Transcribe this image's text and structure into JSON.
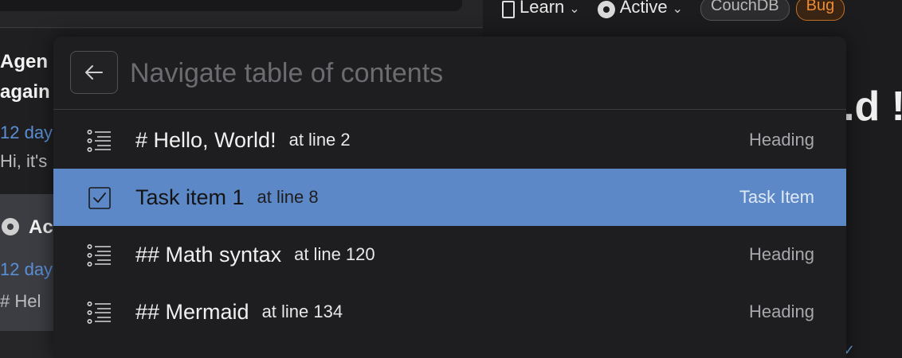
{
  "background": {
    "notes": [
      {
        "title_line1": "Agen",
        "title_line2": "again",
        "date": "12 day",
        "snippet": "Hi, it's"
      },
      {
        "title": "Ac",
        "date": "12 day",
        "snippet": "# Hel"
      }
    ],
    "toolbar": {
      "learn_label": "Learn",
      "status_label": "Active",
      "tags": [
        "CouchDB",
        "Bug"
      ]
    },
    "editor_heading_fragment": ".d !"
  },
  "switcher": {
    "search": {
      "value": "",
      "placeholder": "Navigate table of contents"
    },
    "results": [
      {
        "icon": "list-icon",
        "title": "# Hello, World!",
        "line": "at line 2",
        "kind": "Heading",
        "selected": false
      },
      {
        "icon": "checkbox-icon",
        "title": "Task item 1",
        "line": "at line 8",
        "kind": "Task Item",
        "selected": true
      },
      {
        "icon": "list-icon",
        "title": "## Math syntax",
        "line": "at line 120",
        "kind": "Heading",
        "selected": false
      },
      {
        "icon": "list-icon",
        "title": "## Mermaid",
        "line": "at line 134",
        "kind": "Heading",
        "selected": false
      }
    ]
  },
  "colors": {
    "selection": "#5c88c7",
    "accent_blue": "#5b8fd6",
    "bug_orange": "#ee8a32"
  }
}
